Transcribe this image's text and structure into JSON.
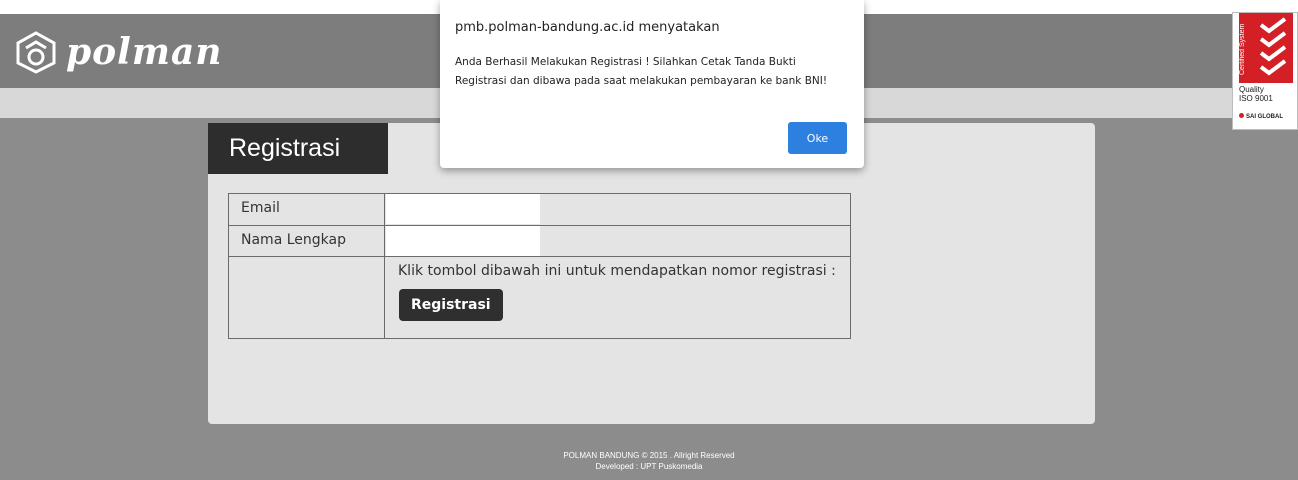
{
  "header": {
    "logo_text": "polman"
  },
  "certificate": {
    "vertical_text": "Certified System",
    "quality_line1": "Quality",
    "quality_line2": "ISO 9001",
    "brand": "SAI GLOBAL"
  },
  "panel": {
    "title": "Registrasi",
    "rows": [
      {
        "label": "Email",
        "value": ""
      },
      {
        "label": "Nama Lengkap",
        "value": ""
      }
    ],
    "instruction": "Klik tombol dibawah ini untuk mendapatkan nomor registrasi :",
    "button_label": "Registrasi"
  },
  "footer": {
    "line1": "POLMAN BANDUNG © 2015 . Allright Reserved",
    "line2": "Developed : UPT Puskomedia"
  },
  "dialog": {
    "title": "pmb.polman-bandung.ac.id menyatakan",
    "message": "Anda Berhasil Melakukan Registrasi ! Silahkan Cetak Tanda Bukti Registrasi dan dibawa pada saat melakukan pembayaran ke bank BNI!",
    "ok_label": "Oke"
  },
  "colors": {
    "accent": "#2d7fe0",
    "header_bg": "#7d7d7d",
    "title_bg": "#2d2d2d",
    "cert_red": "#d32027"
  }
}
